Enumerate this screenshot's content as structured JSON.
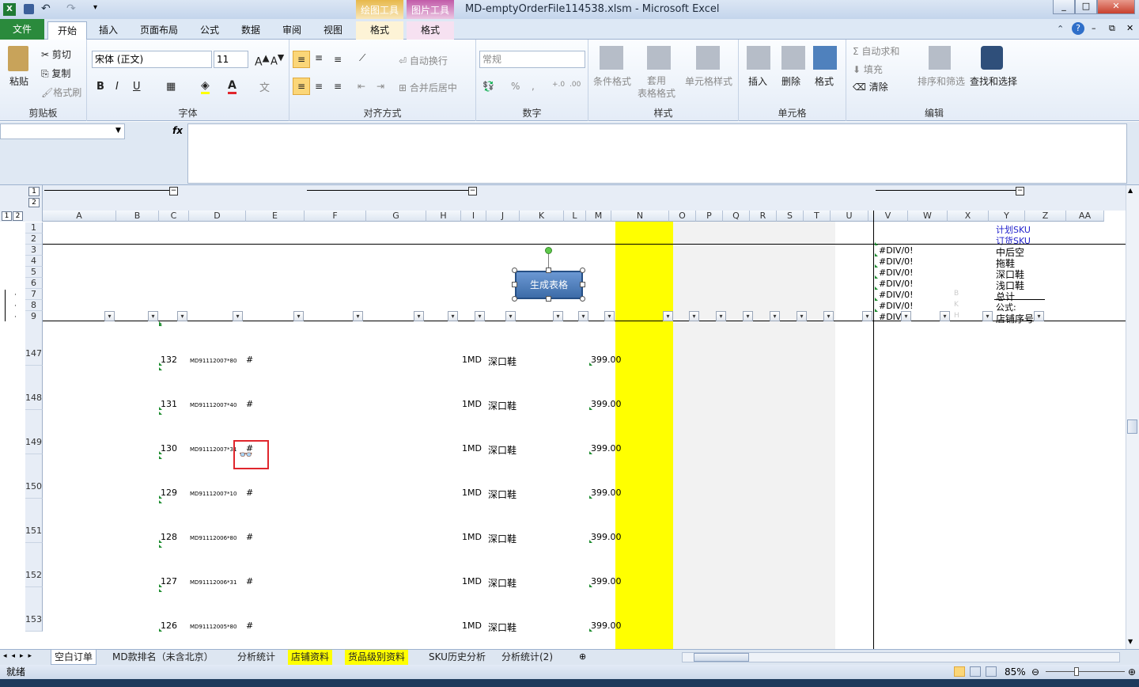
{
  "window": {
    "title": "MD-emptyOrderFile114538.xlsm - Microsoft Excel"
  },
  "quick_access": {
    "icons": [
      "excel-logo-icon",
      "save-icon",
      "undo-icon",
      "redo-icon",
      "customize-icon"
    ]
  },
  "context_tabs": [
    {
      "group": "绘图工具",
      "tab": "格式",
      "color": "#d8a332"
    },
    {
      "group": "图片工具",
      "tab": "格式",
      "color": "#b94fa1"
    }
  ],
  "tabs": [
    "文件",
    "开始",
    "插入",
    "页面布局",
    "公式",
    "数据",
    "审阅",
    "视图"
  ],
  "ribbon": {
    "clipboard": {
      "label": "剪贴板",
      "paste": "粘贴",
      "cut": "剪切",
      "copy": "复制",
      "format_painter": "格式刷"
    },
    "font": {
      "label": "字体",
      "name": "宋体 (正文)",
      "size": "11"
    },
    "alignment": {
      "label": "对齐方式",
      "wrap": "自动换行",
      "merge": "合并后居中"
    },
    "number": {
      "label": "数字",
      "format": "常规"
    },
    "styles": {
      "label": "样式",
      "conditional": "条件格式",
      "table": "套用\n表格格式",
      "cell_styles": "单元格样式"
    },
    "cells": {
      "label": "单元格",
      "insert": "插入",
      "delete": "删除",
      "format": "格式"
    },
    "editing": {
      "label": "编辑",
      "autosum": "自动求和",
      "fill": "填充",
      "clear": "清除",
      "sort": "排序和筛选",
      "find": "查找和选择"
    }
  },
  "formula_bar": {
    "name_box": "",
    "fx": "fx",
    "formula": ""
  },
  "outline_levels": [
    "1",
    "2"
  ],
  "columns": [
    "A",
    "B",
    "C",
    "D",
    "E",
    "F",
    "G",
    "H",
    "I",
    "J",
    "K",
    "L",
    "M",
    "N",
    "O",
    "P",
    "Q",
    "R",
    "S",
    "T",
    "U",
    "V",
    "W",
    "X",
    "Y",
    "Z",
    "AA"
  ],
  "header_rows": [
    "1",
    "2",
    "3",
    "4",
    "5",
    "6",
    "7",
    "8",
    "9"
  ],
  "side_panel": {
    "right_labels": [
      "计划SKU",
      "订货SKU",
      "中后空",
      "拖鞋",
      "深口鞋",
      "浅口鞋",
      "总计",
      "公式:",
      "店铺序号"
    ],
    "errors": [
      "#DIV/0!",
      "#DIV/0!",
      "#DIV/0!",
      "#DIV/0!",
      "#DIV/0!",
      "#DIV/0!",
      "#DIV/("
    ],
    "faint_letters": [
      "B",
      "K",
      "H"
    ]
  },
  "button": {
    "label": "生成表格"
  },
  "data_rows": [
    {
      "row": "147",
      "c": "132",
      "d": "MD91112007*80",
      "e": "#",
      "i": "1MD",
      "j": "深口鞋",
      "m": "399.00"
    },
    {
      "row": "148",
      "c": "131",
      "d": "MD91112007*40",
      "e": "#",
      "i": "1MD",
      "j": "深口鞋",
      "m": "399.00"
    },
    {
      "row": "149",
      "c": "130",
      "d": "MD91112007*31",
      "e": "#",
      "i": "1MD",
      "j": "深口鞋",
      "m": "399.00"
    },
    {
      "row": "150",
      "c": "129",
      "d": "MD91112007*10",
      "e": "#",
      "i": "1MD",
      "j": "深口鞋",
      "m": "399.00"
    },
    {
      "row": "151",
      "c": "128",
      "d": "MD91112006*80",
      "e": "#",
      "i": "1MD",
      "j": "深口鞋",
      "m": "399.00"
    },
    {
      "row": "152",
      "c": "127",
      "d": "MD91112006*31",
      "e": "#",
      "i": "1MD",
      "j": "深口鞋",
      "m": "399.00"
    },
    {
      "row": "153",
      "c": "126",
      "d": "MD91112005*80",
      "e": "#",
      "i": "1MD",
      "j": "深口鞋",
      "m": "399.00"
    }
  ],
  "sheet_tabs": [
    "空白订单",
    "MD款排名（未含北京）",
    "分析统计",
    "店铺资料",
    "货品级别资料",
    "SKU历史分析",
    "分析统计(2)"
  ],
  "status": {
    "ready": "就绪",
    "zoom": "85%"
  },
  "colors": {
    "highlight_column": "#ffff00",
    "gray_band": "#f2f2f2",
    "selection": "#e0262d",
    "button_fill": "#4f81bd"
  }
}
